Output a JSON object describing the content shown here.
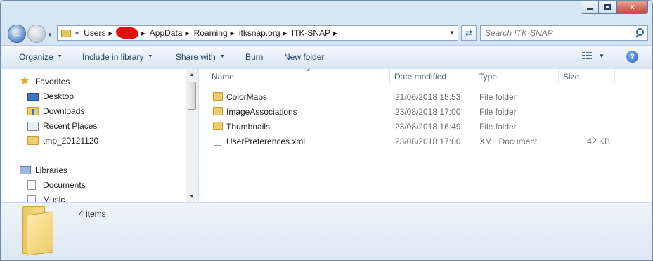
{
  "window": {
    "caption_close": "x"
  },
  "nav": {
    "back_icon": "arrow-left-icon",
    "forward_icon": "arrow-right-icon"
  },
  "address": {
    "chevron": "«",
    "crumbs": [
      "Users",
      "AppData",
      "Roaming",
      "itksnap.org",
      "ITK-SNAP"
    ]
  },
  "search": {
    "placeholder": "Search ITK-SNAP"
  },
  "toolbar": {
    "organize": "Organize",
    "include_in_library": "Include in library",
    "share_with": "Share with",
    "burn": "Burn",
    "new_folder": "New folder",
    "help": "?"
  },
  "sidebar": {
    "favorites_label": "Favorites",
    "favorites": [
      {
        "label": "Desktop",
        "icon": "desktop-icon"
      },
      {
        "label": "Downloads",
        "icon": "downloads-icon"
      },
      {
        "label": "Recent Places",
        "icon": "recent-places-icon"
      },
      {
        "label": "tmp_20121120",
        "icon": "folder-icon"
      }
    ],
    "libraries_label": "Libraries",
    "libraries": [
      {
        "label": "Documents",
        "icon": "documents-icon"
      },
      {
        "label": "Music",
        "icon": "music-icon"
      }
    ]
  },
  "columns": {
    "name": "Name",
    "date_modified": "Date modified",
    "type": "Type",
    "size": "Size"
  },
  "files": [
    {
      "name": "ColorMaps",
      "date": "21/06/2018 15:53",
      "type": "File folder",
      "size": "",
      "icon": "folder-icon"
    },
    {
      "name": "ImageAssociations",
      "date": "23/08/2018 17:00",
      "type": "File folder",
      "size": "",
      "icon": "folder-icon"
    },
    {
      "name": "Thumbnails",
      "date": "23/08/2018 16:49",
      "type": "File folder",
      "size": "",
      "icon": "folder-icon"
    },
    {
      "name": "UserPreferences.xml",
      "date": "23/08/2018 17:00",
      "type": "XML Document",
      "size": "42 KB",
      "icon": "xml-file-icon"
    }
  ],
  "details": {
    "item_count": "4 items"
  },
  "colors": {
    "accent": "#2f66b4",
    "folder": "#f0cf6b",
    "redaction": "#e10f0f"
  }
}
